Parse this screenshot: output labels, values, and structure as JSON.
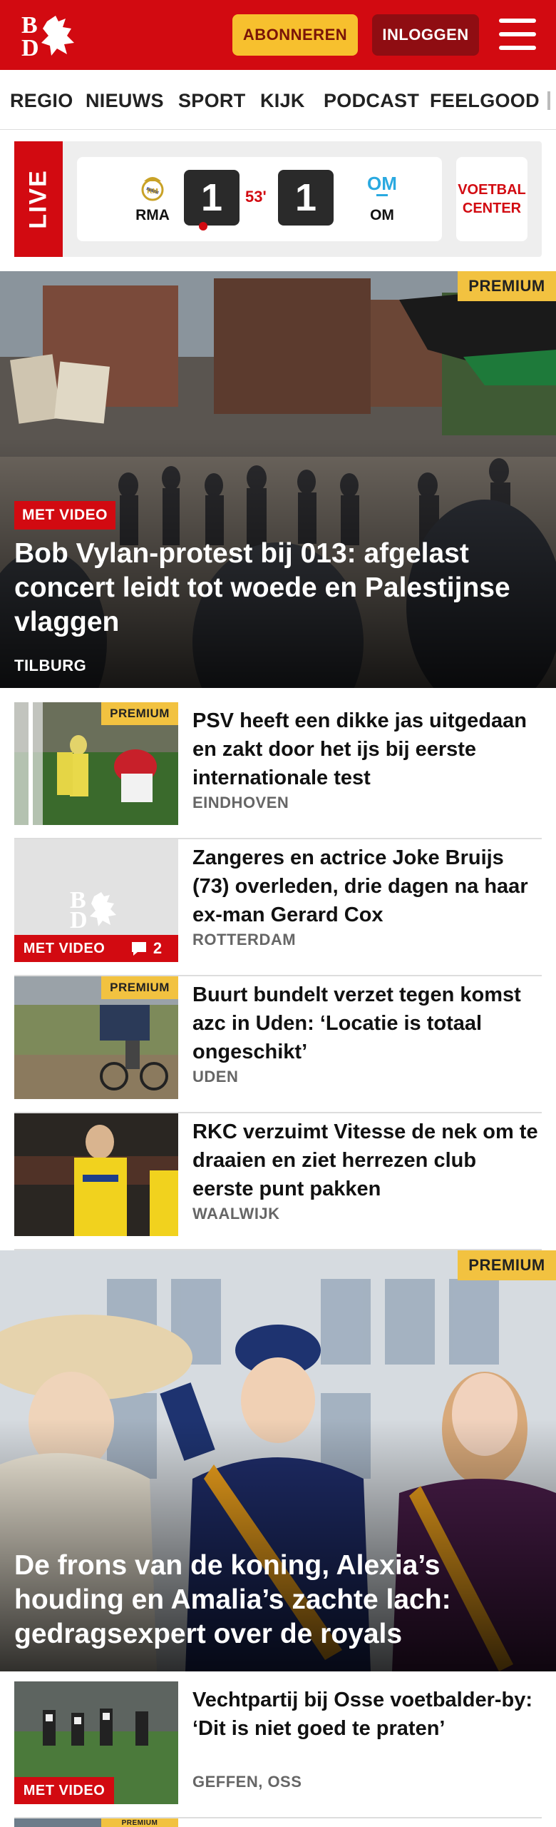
{
  "header": {
    "logo_alt": "BD",
    "subscribe_label": "ABONNEREN",
    "login_label": "INLOGGEN",
    "brand_color": "#d20a11"
  },
  "nav": {
    "items": [
      "REGIO",
      "NIEUWS",
      "SPORT",
      "KIJK",
      "PODCAST",
      "FEELGOOD"
    ]
  },
  "live": {
    "label": "LIVE",
    "home_team": "RMA",
    "away_team": "OM",
    "home_score": "1",
    "away_score": "1",
    "minute": "53'",
    "voetbal_center": "VOETBAL CENTER"
  },
  "hero1": {
    "premium": "PREMIUM",
    "badge": "MET VIDEO",
    "title": "Bob Vylan-protest bij 013: afgelast concert leidt tot woede en Palestijnse vlaggen",
    "location": "TILBURG"
  },
  "articles": [
    {
      "premium": "PREMIUM",
      "title": "PSV heeft een dikke jas uitgedaan en zakt door het ijs bij eerste internationale test",
      "location": "EINDHOVEN"
    },
    {
      "badge": "MET VIDEO",
      "comments": "2",
      "title": "Zangeres en actrice Joke Bruijs (73) overleden, drie dagen na haar ex-man Gerard Cox",
      "location": "ROTTERDAM"
    },
    {
      "premium": "PREMIUM",
      "title": "Buurt bundelt verzet tegen komst azc in Uden: ‘Locatie is totaal ongeschikt’",
      "location": "UDEN"
    },
    {
      "title": "RKC verzuimt Vitesse de nek om te draaien en ziet herrezen club eerste punt pakken",
      "location": "WAALWIJK"
    }
  ],
  "hero2": {
    "premium": "PREMIUM",
    "title": "De frons van de koning, Alexia’s houding en Amalia’s zachte lach: gedragsexpert over de royals"
  },
  "article_last": {
    "badge": "MET VIDEO",
    "title": "Vechtpartij bij Osse voetbalder-by: ‘Dit is niet goed te praten’",
    "location": "GEFFEN, OSS"
  },
  "partial_next": {
    "premium": "PREMIUM"
  }
}
